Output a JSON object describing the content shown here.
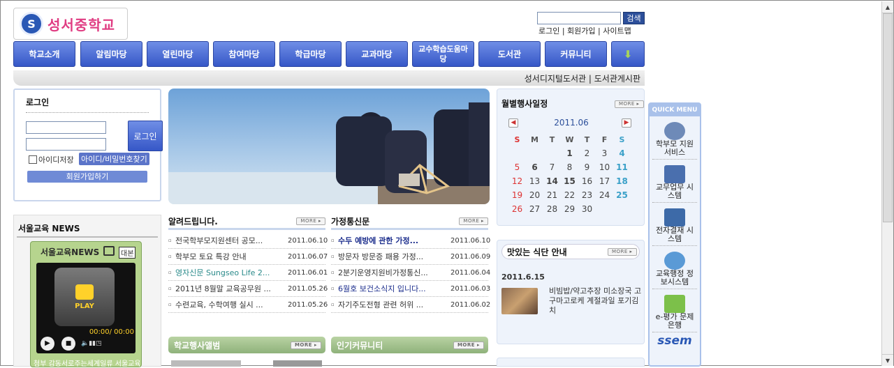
{
  "header": {
    "logo_text": "성서중학교",
    "search_button": "검색",
    "top_links": "로그인 | 회원가입 | 사이트맵"
  },
  "nav": [
    {
      "label": "학교소개"
    },
    {
      "label": "알림마당"
    },
    {
      "label": "열린마당"
    },
    {
      "label": "참여마당"
    },
    {
      "label": "학급마당"
    },
    {
      "label": "교과마당"
    },
    {
      "label": "교수학습도움마당"
    },
    {
      "label": "도서관"
    },
    {
      "label": "커뮤니티"
    },
    {
      "label": "⬇"
    }
  ],
  "subbar": "성서디지털도서관 | 도서관게시판",
  "login": {
    "title": "로그인",
    "button": "로그인",
    "save_id": "아이디저장",
    "find": "아이디/비밀번호찾기",
    "join": "회원가입하기"
  },
  "news": {
    "title": "서울교육 NEWS",
    "logo": "서울교육NEWS",
    "tag": "대본",
    "play": "PLAY",
    "time": "00:00/ 00:00",
    "caption": "첨부 감동서로주는세계일류 서울교육"
  },
  "notice": {
    "title": "알려드립니다.",
    "more": "MORE ▸",
    "items": [
      {
        "text": "전국학부모지원센터 공모...",
        "date": "2011.06.10"
      },
      {
        "text": "학부모 토요 특강 안내",
        "date": "2011.06.07"
      },
      {
        "text": "영자신문 Sungseo Life 2...",
        "date": "2011.06.01"
      },
      {
        "text": "2011년 8월말 교육공무원 ...",
        "date": "2011.05.26"
      },
      {
        "text": "수련교육, 수학여행 실시 ...",
        "date": "2011.05.26"
      }
    ]
  },
  "family": {
    "title": "가정통신문",
    "more": "MORE ▸",
    "items": [
      {
        "text": "수두 예방에 관한 가정...",
        "date": "2011.06.10"
      },
      {
        "text": "방문자 방문증 패용 가정...",
        "date": "2011.06.09"
      },
      {
        "text": "2분기운영지원비가정통신...",
        "date": "2011.06.04"
      },
      {
        "text": "6월호 보건소식지 입니다...",
        "date": "2011.06.03"
      },
      {
        "text": "자기주도전형 관련 허위 ...",
        "date": "2011.06.02"
      }
    ]
  },
  "album": {
    "title": "학교행사앨범",
    "more": "MORE ▸"
  },
  "community": {
    "title": "인기커뮤니티",
    "more": "MORE ▸"
  },
  "calendar": {
    "title": "월별행사일정",
    "more": "MORE ▸",
    "month": "2011.06",
    "days": [
      "S",
      "M",
      "T",
      "W",
      "T",
      "F",
      "S"
    ],
    "dates": [
      "",
      "",
      "",
      "1",
      "2",
      "3",
      "4",
      "5",
      "6",
      "7",
      "8",
      "9",
      "10",
      "11",
      "12",
      "13",
      "14",
      "15",
      "16",
      "17",
      "18",
      "19",
      "20",
      "21",
      "22",
      "23",
      "24",
      "25",
      "26",
      "27",
      "28",
      "29",
      "30",
      "",
      ""
    ]
  },
  "meal": {
    "title": "맛있는 식단 안내",
    "more": "MORE ▸",
    "date": "2011.6.15",
    "menu": "비빔밥/약고추장 미소장국 고구마고로케 계절과일 포기김치"
  },
  "quick": {
    "title": "QUICK MENU",
    "items": [
      "학부모 지원서비스",
      "교무업무 시스템",
      "전자결재 시스템",
      "교육행정 정보시스템",
      "e-평가 문제은행"
    ],
    "ssem": "ssem"
  },
  "colors": {
    "nav": "#3657c7",
    "accent": "#2c4f9a",
    "sunday": "#d33",
    "saturday": "#3aa0c8",
    "green": "#8fb27b"
  }
}
